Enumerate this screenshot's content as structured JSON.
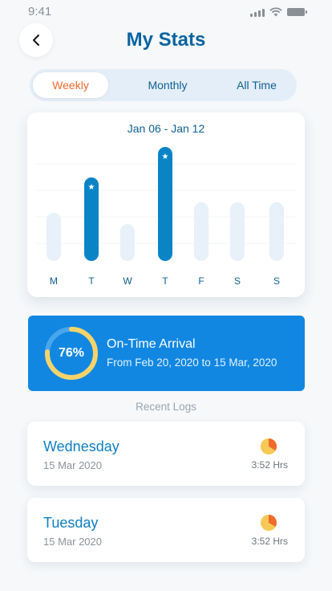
{
  "status_bar": {
    "time": "9:41"
  },
  "header": {
    "title": "My Stats",
    "back_icon": "chevron-left-icon"
  },
  "tabs": [
    {
      "label": "Weekly",
      "active": true
    },
    {
      "label": "Monthly",
      "active": false
    },
    {
      "label": "All Time",
      "active": false
    }
  ],
  "chart_data": {
    "type": "bar",
    "title": "Jan 06 - Jan 12",
    "categories": [
      "M",
      "T",
      "W",
      "T",
      "F",
      "S",
      "S"
    ],
    "values": [
      60,
      104,
      46,
      142,
      73,
      73,
      73
    ],
    "highlighted": [
      false,
      true,
      false,
      true,
      false,
      false,
      false
    ],
    "ylim": [
      0,
      150
    ],
    "grid": true,
    "colors": {
      "highlight": "#0b84c6",
      "normal": "#e8f0f9",
      "marker": "star-icon"
    }
  },
  "arrival": {
    "percent_label": "76%",
    "percent": 76,
    "title": "On-Time Arrival",
    "range": "From Feb 20, 2020 to 15 Mar, 2020",
    "colors": {
      "card": "#1187e2",
      "ring": "#f5d36a"
    }
  },
  "recent_logs": {
    "label": "Recent Logs",
    "items": [
      {
        "day": "Wednesday",
        "date": "15 Mar 2020",
        "duration": "3:52 Hrs",
        "icon": "pie-chart-icon"
      },
      {
        "day": "Tuesday",
        "date": "15 Mar 2020",
        "duration": "3:52 Hrs",
        "icon": "pie-chart-icon"
      }
    ]
  }
}
